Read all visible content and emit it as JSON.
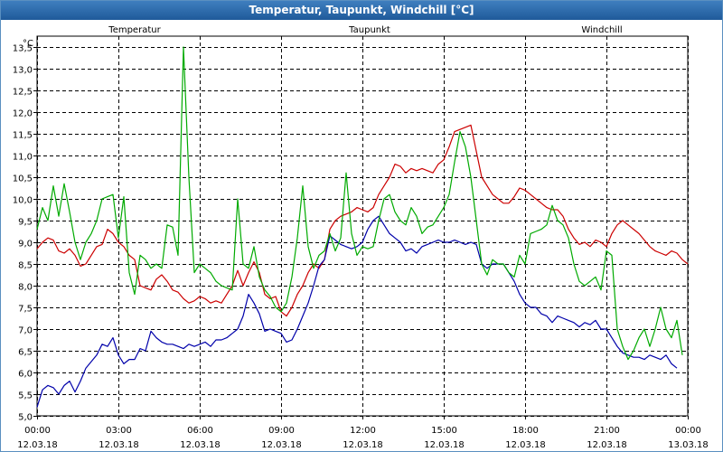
{
  "window": {
    "title": "Temperatur, Taupunkt, Windchill [°C]"
  },
  "chart_data": {
    "type": "line",
    "title": "Temperatur, Taupunkt, Windchill [°C]",
    "ylabel": "°C",
    "xlabel": "",
    "ylim": [
      5.0,
      13.75
    ],
    "xlim": [
      0,
      24
    ],
    "grid": true,
    "legend_placement": "top",
    "y_ticks": [
      "5,0",
      "5,5",
      "6,0",
      "6,5",
      "7,0",
      "7,5",
      "8,0",
      "8,5",
      "9,0",
      "9,5",
      "10,0",
      "10,5",
      "11,0",
      "11,5",
      "12,0",
      "12,5",
      "13,0",
      "13,5"
    ],
    "x_ticks": [
      {
        "time": "00:00",
        "date": "12.03.18"
      },
      {
        "time": "03:00",
        "date": "12.03.18"
      },
      {
        "time": "06:00",
        "date": "12.03.18"
      },
      {
        "time": "09:00",
        "date": "12.03.18"
      },
      {
        "time": "12:00",
        "date": "12.03.18"
      },
      {
        "time": "15:00",
        "date": "12.03.18"
      },
      {
        "time": "18:00",
        "date": "12.03.18"
      },
      {
        "time": "21:00",
        "date": "12.03.18"
      },
      {
        "time": "00:00",
        "date": "13.03.18"
      }
    ],
    "x_hours": [
      0,
      0.2,
      0.4,
      0.6,
      0.8,
      1,
      1.2,
      1.4,
      1.6,
      1.8,
      2,
      2.2,
      2.4,
      2.6,
      2.8,
      3,
      3.2,
      3.4,
      3.6,
      3.8,
      4,
      4.2,
      4.4,
      4.6,
      4.8,
      5,
      5.2,
      5.4,
      5.6,
      5.8,
      6,
      6.2,
      6.4,
      6.6,
      6.8,
      7,
      7.2,
      7.4,
      7.6,
      7.8,
      8,
      8.2,
      8.4,
      8.6,
      8.8,
      9,
      9.2,
      9.4,
      9.6,
      9.8,
      10,
      10.2,
      10.4,
      10.6,
      10.8,
      11,
      11.2,
      11.4,
      11.6,
      11.8,
      12,
      12.2,
      12.4,
      12.6,
      12.8,
      13,
      13.2,
      13.4,
      13.6,
      13.8,
      14,
      14.2,
      14.4,
      14.6,
      14.8,
      15,
      15.2,
      15.4,
      15.6,
      15.8,
      16,
      16.2,
      16.4,
      16.6,
      16.8,
      17,
      17.2,
      17.4,
      17.6,
      17.8,
      18,
      18.2,
      18.4,
      18.6,
      18.8,
      19,
      19.2,
      19.4,
      19.6,
      19.8,
      20,
      20.2,
      20.4,
      20.6,
      20.8,
      21,
      21.2,
      21.4,
      21.6,
      21.8,
      22,
      22.2,
      22.4,
      22.6,
      22.8,
      23,
      23.2,
      23.4,
      23.6,
      23.8,
      24
    ],
    "series": [
      {
        "name": "Temperatur",
        "color": "#cc0000",
        "values": [
          8.85,
          9.0,
          9.1,
          9.05,
          8.8,
          8.75,
          8.85,
          8.7,
          8.45,
          8.5,
          8.7,
          8.9,
          8.95,
          9.3,
          9.2,
          9.0,
          8.9,
          8.7,
          8.6,
          8.0,
          7.95,
          7.9,
          8.15,
          8.25,
          8.1,
          7.9,
          7.85,
          7.7,
          7.6,
          7.65,
          7.75,
          7.7,
          7.6,
          7.65,
          7.6,
          7.8,
          8.0,
          8.35,
          8.0,
          8.3,
          8.55,
          8.3,
          7.8,
          7.7,
          7.75,
          7.4,
          7.3,
          7.5,
          7.8,
          8.0,
          8.3,
          8.5,
          8.4,
          8.6,
          9.3,
          9.5,
          9.6,
          9.65,
          9.7,
          9.8,
          9.75,
          9.7,
          9.8,
          10.1,
          10.3,
          10.5,
          10.8,
          10.75,
          10.6,
          10.7,
          10.65,
          10.7,
          10.65,
          10.6,
          10.8,
          10.9,
          11.2,
          11.55,
          11.6,
          11.65,
          11.7,
          11.1,
          10.5,
          10.3,
          10.1,
          10.0,
          9.9,
          9.9,
          10.05,
          10.25,
          10.2,
          10.1,
          10.0,
          9.9,
          9.8,
          9.75,
          9.75,
          9.6,
          9.3,
          9.1,
          8.95,
          9.0,
          8.9,
          9.05,
          9.0,
          8.9,
          9.2,
          9.4,
          9.5,
          9.4,
          9.3,
          9.2,
          9.05,
          8.9,
          8.8,
          8.75,
          8.7,
          8.8,
          8.75,
          8.6,
          8.5
        ]
      },
      {
        "name": "Taupunkt",
        "color": "#0000aa",
        "values": [
          5.2,
          5.6,
          5.7,
          5.65,
          5.5,
          5.7,
          5.8,
          5.55,
          5.8,
          6.1,
          6.25,
          6.4,
          6.65,
          6.6,
          6.8,
          6.4,
          6.2,
          6.3,
          6.3,
          6.55,
          6.5,
          6.95,
          6.8,
          6.7,
          6.65,
          6.65,
          6.6,
          6.55,
          6.65,
          6.6,
          6.65,
          6.7,
          6.6,
          6.75,
          6.75,
          6.8,
          6.9,
          7.0,
          7.3,
          7.8,
          7.6,
          7.35,
          6.95,
          7.0,
          6.95,
          6.9,
          6.7,
          6.75,
          7.0,
          7.3,
          7.6,
          8.0,
          8.45,
          8.6,
          9.15,
          9.05,
          8.95,
          8.9,
          8.85,
          8.9,
          9.0,
          9.3,
          9.5,
          9.6,
          9.4,
          9.2,
          9.1,
          9.0,
          8.8,
          8.85,
          8.75,
          8.9,
          8.95,
          9.0,
          9.05,
          9.0,
          9.0,
          9.05,
          9.0,
          8.95,
          9.0,
          8.95,
          8.5,
          8.4,
          8.5,
          8.5,
          8.5,
          8.3,
          8.1,
          7.8,
          7.6,
          7.5,
          7.5,
          7.35,
          7.3,
          7.15,
          7.3,
          7.25,
          7.2,
          7.15,
          7.05,
          7.15,
          7.1,
          7.2,
          7.0,
          7.0,
          6.8,
          6.6,
          6.45,
          6.4,
          6.35,
          6.35,
          6.3,
          6.4,
          6.35,
          6.3,
          6.4,
          6.2,
          6.1
        ]
      },
      {
        "name": "Windchill",
        "color": "#00aa00",
        "values": [
          9.3,
          9.8,
          9.5,
          10.3,
          9.6,
          10.35,
          9.7,
          9.0,
          8.6,
          9.0,
          9.2,
          9.5,
          10.0,
          10.05,
          10.1,
          9.1,
          10.05,
          8.3,
          7.8,
          8.7,
          8.6,
          8.4,
          8.5,
          8.4,
          9.4,
          9.35,
          8.7,
          13.5,
          10.5,
          8.3,
          8.5,
          8.4,
          8.3,
          8.1,
          8.0,
          7.95,
          7.9,
          10.0,
          8.5,
          8.4,
          8.9,
          8.2,
          7.9,
          7.75,
          7.5,
          7.4,
          7.6,
          8.2,
          9.1,
          10.3,
          8.9,
          8.4,
          8.7,
          8.8,
          9.2,
          8.8,
          9.1,
          10.6,
          9.2,
          8.7,
          8.9,
          8.85,
          8.9,
          9.5,
          10.0,
          10.1,
          9.7,
          9.5,
          9.4,
          9.8,
          9.6,
          9.2,
          9.35,
          9.4,
          9.6,
          9.8,
          10.1,
          10.85,
          11.55,
          11.2,
          10.5,
          9.5,
          8.5,
          8.25,
          8.6,
          8.5,
          8.5,
          8.3,
          8.2,
          8.7,
          8.5,
          9.2,
          9.25,
          9.3,
          9.4,
          9.85,
          9.5,
          9.4,
          9.1,
          8.5,
          8.1,
          8.0,
          8.1,
          8.2,
          7.9,
          8.8,
          8.7,
          7.0,
          6.6,
          6.3,
          6.5,
          6.8,
          7.0,
          6.6,
          7.0,
          7.5,
          7.0,
          6.8,
          7.2,
          6.4
        ]
      }
    ]
  }
}
